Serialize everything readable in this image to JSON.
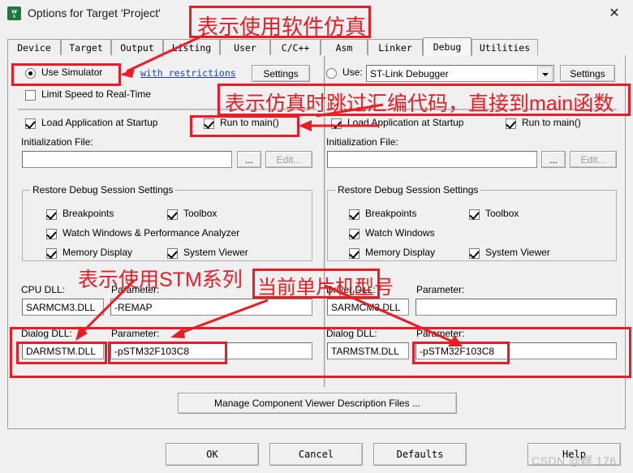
{
  "window": {
    "title": "Options for Target 'Project'",
    "icon": "keil-uvision-icon",
    "close_label": "✕"
  },
  "tabs": [
    {
      "label": "Device",
      "selected": false
    },
    {
      "label": "Target",
      "selected": false
    },
    {
      "label": "Output",
      "selected": false
    },
    {
      "label": "Listing",
      "selected": false
    },
    {
      "label": "User",
      "selected": false
    },
    {
      "label": "C/C++",
      "selected": false
    },
    {
      "label": "Asm",
      "selected": false
    },
    {
      "label": "Linker",
      "selected": false
    },
    {
      "label": "Debug",
      "selected": true
    },
    {
      "label": "Utilities",
      "selected": false
    }
  ],
  "left": {
    "use_simulator_label": "Use Simulator",
    "use_simulator_checked": true,
    "with_restrictions_link": "with restrictions",
    "settings_button": "Settings",
    "limit_speed_label": "Limit Speed to Real-Time",
    "limit_speed_checked": false,
    "load_app_label": "Load Application at Startup",
    "load_app_checked": true,
    "run_to_main_label": "Run to main()",
    "run_to_main_checked": true,
    "init_file_label": "Initialization File:",
    "init_file_value": "",
    "browse_button": "...",
    "edit_button": "Edit...",
    "restore_group_title": "Restore Debug Session Settings",
    "restore_items": [
      {
        "label": "Breakpoints",
        "checked": true
      },
      {
        "label": "Toolbox",
        "checked": true
      },
      {
        "label": "Watch Windows & Performance Analyzer",
        "checked": true
      },
      {
        "label": "Memory Display",
        "checked": true
      },
      {
        "label": "System Viewer",
        "checked": true
      }
    ],
    "cpu_dll_label": "CPU DLL:",
    "cpu_dll_value": "SARMCM3.DLL",
    "cpu_param_label": "Parameter:",
    "cpu_param_value": "-REMAP",
    "dialog_dll_label": "Dialog DLL:",
    "dialog_dll_value": "DARMSTM.DLL",
    "dialog_param_label": "Parameter:",
    "dialog_param_value": "-pSTM32F103C8"
  },
  "right": {
    "use_label": "Use:",
    "use_checked": false,
    "debugger_value": "ST-Link Debugger",
    "settings_button": "Settings",
    "load_app_label": "Load Application at Startup",
    "load_app_checked": true,
    "run_to_main_label": "Run to main()",
    "run_to_main_checked": true,
    "init_file_label": "Initialization File:",
    "init_file_value": "",
    "browse_button": "...",
    "edit_button": "Edit...",
    "restore_group_title": "Restore Debug Session Settings",
    "restore_items": [
      {
        "label": "Breakpoints",
        "checked": true
      },
      {
        "label": "Toolbox",
        "checked": true
      },
      {
        "label": "Watch Windows",
        "checked": true
      },
      {
        "label": "Memory Display",
        "checked": true
      },
      {
        "label": "System Viewer",
        "checked": true
      }
    ],
    "driver_dll_label": "Driver DLL:",
    "driver_dll_value": "SARMCM3.DLL",
    "driver_param_label": "Parameter:",
    "driver_param_value": "",
    "dialog_dll_label": "Dialog DLL:",
    "dialog_dll_value": "TARMSTM.DLL",
    "dialog_param_label": "Parameter:",
    "dialog_param_value": "-pSTM32F103C8"
  },
  "manage_button": "Manage Component Viewer Description Files ...",
  "footer": {
    "ok": "OK",
    "cancel": "Cancel",
    "defaults": "Defaults",
    "help": "Help"
  },
  "annotations": {
    "color": "#ec1c24",
    "a1": "表示使用软件仿真",
    "a2": "表示仿真时跳过汇编代码，直接到main函数",
    "a3": "表示使用STM系列",
    "a4": "当前单片机型号"
  },
  "watermark": "CSDN @群 176"
}
